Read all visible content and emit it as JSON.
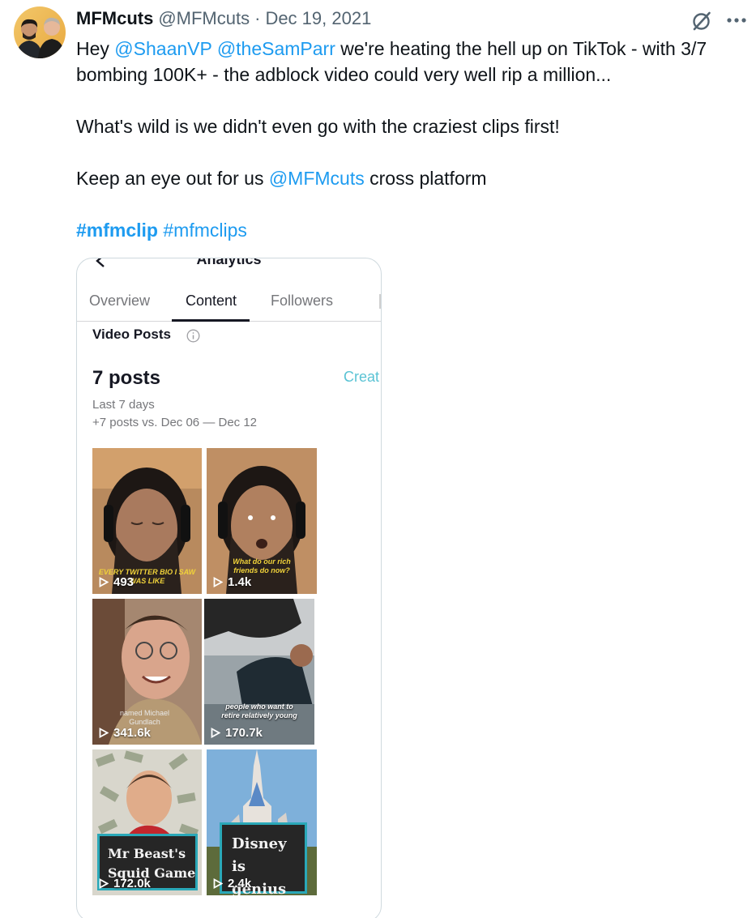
{
  "author": {
    "display_name": "MFMcuts",
    "handle": "@MFMcuts",
    "separator": "·",
    "date": "Dec 19, 2021"
  },
  "actions": {
    "grok_icon": "grok-icon",
    "more_icon": "more-horizontal-icon"
  },
  "tweet": {
    "line1_pre": "Hey ",
    "mention_shaan": "@ShaanVP",
    "mention_sam": "@theSamParr",
    "line1_post": " we're heating the hell up on TikTok - with 3/7 bombing 100K+ - the adblock video could very well rip a million...",
    "para2": "What's wild is we didn't even go with the craziest clips first!",
    "para3_pre": "Keep an eye out for us ",
    "mention_mfm": "@MFMcuts",
    "para3_post": " cross platform",
    "hashtag1": "#mfmclip",
    "hashtag2": "#mfmclips"
  },
  "media": {
    "title": "Analytics",
    "tabs": [
      "Overview",
      "Content",
      "Followers"
    ],
    "active_tab": "Content",
    "section_label": "Video Posts",
    "posts_count": "7 posts",
    "create_link": "Creat",
    "period": "Last 7 days",
    "comparison": "+7 posts vs. Dec 06 — Dec 12",
    "videos": [
      {
        "views": "493",
        "caption": "EVERY TWITTER BIO I SAW WAS LIKE"
      },
      {
        "views": "1.4k",
        "caption": "What do our rich friends do now?"
      },
      {
        "views": "341.6k",
        "caption": "named Michael Gundlach"
      },
      {
        "views": "170.7k",
        "caption": "people who want to retire relatively young"
      },
      {
        "views": "172.0k",
        "caption": "Mr Beast's Squid Game"
      },
      {
        "views": "2.4k",
        "caption": "Disney is genius"
      }
    ]
  },
  "colors": {
    "link": "#1d9bf0",
    "text": "#0f1419",
    "muted": "#536471",
    "teal": "#5ac3d4"
  }
}
